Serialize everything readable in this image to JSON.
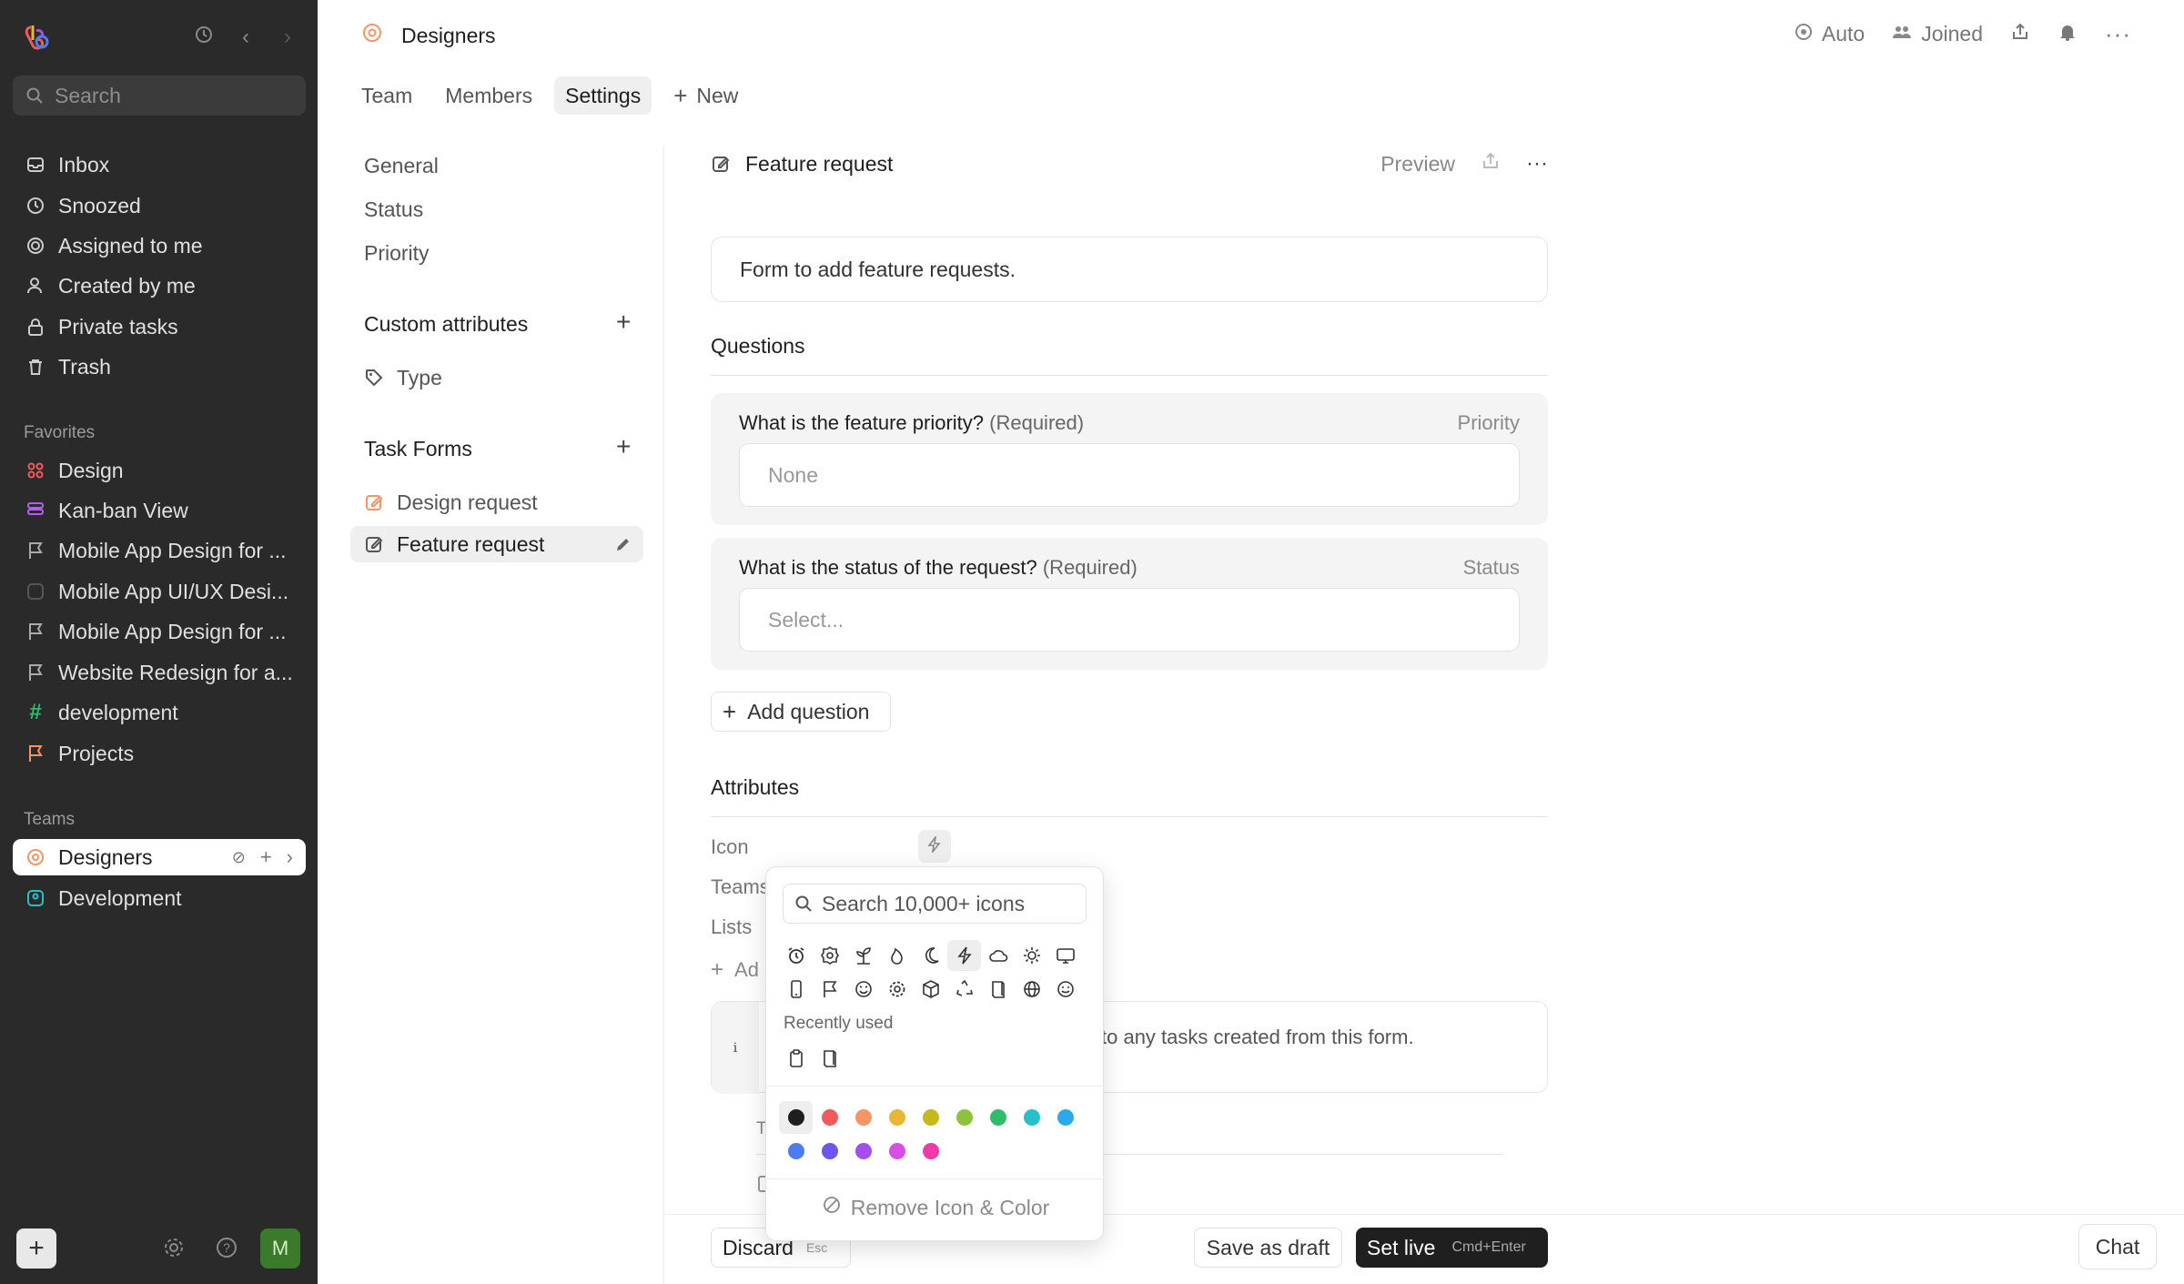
{
  "sidebar": {
    "search_placeholder": "Search",
    "nav": [
      "Inbox",
      "Snoozed",
      "Assigned to me",
      "Created by me",
      "Private tasks",
      "Trash"
    ],
    "favorites_label": "Favorites",
    "favorites": [
      "Design",
      "Kan-ban View",
      "Mobile App Design for ...",
      "Mobile App UI/UX Desi...",
      "Mobile App Design for ...",
      "Website Redesign for a...",
      "development",
      "Projects"
    ],
    "teams_label": "Teams",
    "teams": [
      "Designers",
      "Development"
    ],
    "avatar": "M"
  },
  "topbar": {
    "title": "Designers",
    "auto": "Auto",
    "joined": "Joined"
  },
  "tabs": [
    "Team",
    "Members",
    "Settings",
    "New"
  ],
  "settings_nav": {
    "items": [
      "General",
      "Status",
      "Priority"
    ],
    "custom_attributes": "Custom attributes",
    "type": "Type",
    "task_forms": "Task Forms",
    "forms": [
      "Design request",
      "Feature request"
    ]
  },
  "form": {
    "title": "Feature request",
    "preview": "Preview",
    "description": "Form to add feature requests.",
    "questions_title": "Questions",
    "questions": [
      {
        "label": "What is the feature priority?",
        "required": "(Required)",
        "type": "Priority",
        "value": "None"
      },
      {
        "label": "What is the status of the request?",
        "required": "(Required)",
        "type": "Status",
        "value": "Select..."
      }
    ],
    "add_question": "Add question",
    "attributes_title": "Attributes",
    "attr_icon": "Icon",
    "attr_teams": "Teams",
    "attr_lists": "Lists",
    "add_attr": "Ad",
    "info_text": "ly to any tasks created from this form.",
    "info_letter": "i",
    "below_letter": "T"
  },
  "icon_picker": {
    "search_placeholder": "Search 10,000+ icons",
    "icons_row1": [
      "alarm-icon",
      "badge-icon",
      "plant-icon",
      "flame-icon",
      "moon-icon",
      "bolt-icon",
      "cloud-icon",
      "sun-icon",
      "monitor-icon"
    ],
    "icons_row2": [
      "phone-icon",
      "flag-icon",
      "smile-face-icon",
      "gear-icon",
      "box-icon",
      "recycle-icon",
      "book-icon",
      "globe-icon",
      "smiley-icon"
    ],
    "recently_used_label": "Recently used",
    "recent_icons": [
      "clipboard-icon",
      "book-icon"
    ],
    "colors_row1": [
      "#1f1f1f",
      "#f05a5a",
      "#f59564",
      "#e8b534",
      "#c5b91d",
      "#8cc33a",
      "#2fbd6b",
      "#26c0c9",
      "#2aa9ec"
    ],
    "colors_row2": [
      "#4c7cf0",
      "#6c55f0",
      "#a54ef0",
      "#d84ee8",
      "#f03aa8"
    ],
    "remove_label": "Remove Icon & Color"
  },
  "footer": {
    "discard": "Discard",
    "discard_kbd": "Esc",
    "save_draft": "Save as draft",
    "set_live": "Set live",
    "set_live_kbd": "Cmd+Enter",
    "chat": "Chat"
  }
}
